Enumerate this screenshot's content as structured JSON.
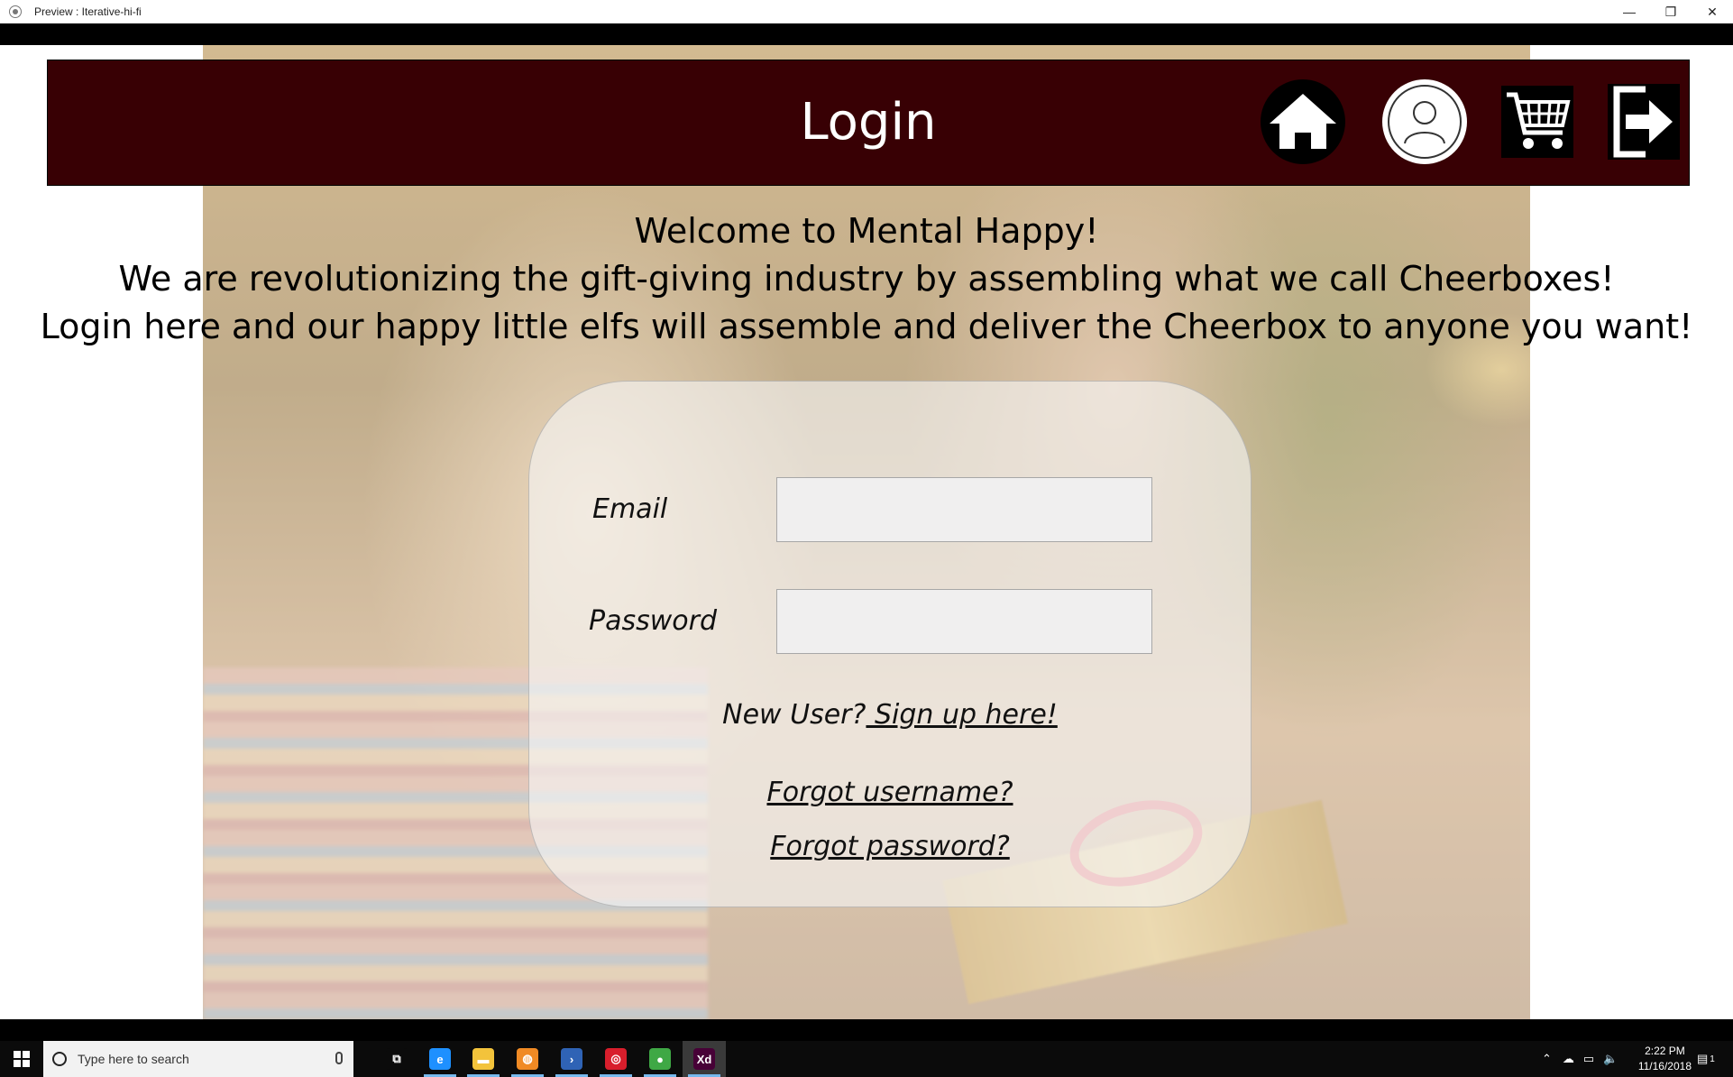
{
  "window": {
    "title": "Preview : Iterative-hi-fi",
    "minimize": "—",
    "restore": "❐",
    "close": "✕"
  },
  "header": {
    "title": "Login",
    "background": "#380004",
    "nav": [
      {
        "icon": "home-icon"
      },
      {
        "icon": "profile-icon"
      },
      {
        "icon": "cart-icon"
      },
      {
        "icon": "logout-icon"
      }
    ]
  },
  "welcome": {
    "line1": "Welcome to Mental Happy!",
    "line2": "We are revolutionizing the gift-giving industry by assembling what we call Cheerboxes!",
    "line3": "Login here and our happy little elfs will assemble and deliver the Cheerbox to anyone you want!"
  },
  "login": {
    "email_label": "Email",
    "email_value": "",
    "password_label": "Password",
    "password_value": "",
    "new_user_text": "New User?",
    "signup_link": " Sign up here!",
    "forgot_username": "Forgot username?",
    "forgot_password": "Forgot password?"
  },
  "taskbar": {
    "search_placeholder": "Type here to search",
    "apps": [
      {
        "icon": "task-view-icon",
        "glyph": "⧉",
        "color": "#0b0b0b"
      },
      {
        "icon": "edge-icon",
        "glyph": "e",
        "color": "#1e90ff"
      },
      {
        "icon": "file-explorer-icon",
        "glyph": "▬",
        "color": "#f3c33b"
      },
      {
        "icon": "orange-app-icon",
        "glyph": "◍",
        "color": "#f08a24"
      },
      {
        "icon": "powershell-icon",
        "glyph": "›",
        "color": "#2f63b5"
      },
      {
        "icon": "red-app-icon",
        "glyph": "◎",
        "color": "#d81e2c"
      },
      {
        "icon": "chrome-icon",
        "glyph": "●",
        "color": "#3fa845"
      },
      {
        "icon": "xd-icon",
        "glyph": "Xd",
        "color": "#470137"
      }
    ],
    "time": "2:22 PM",
    "date": "11/16/2018",
    "notification_count": "1"
  }
}
